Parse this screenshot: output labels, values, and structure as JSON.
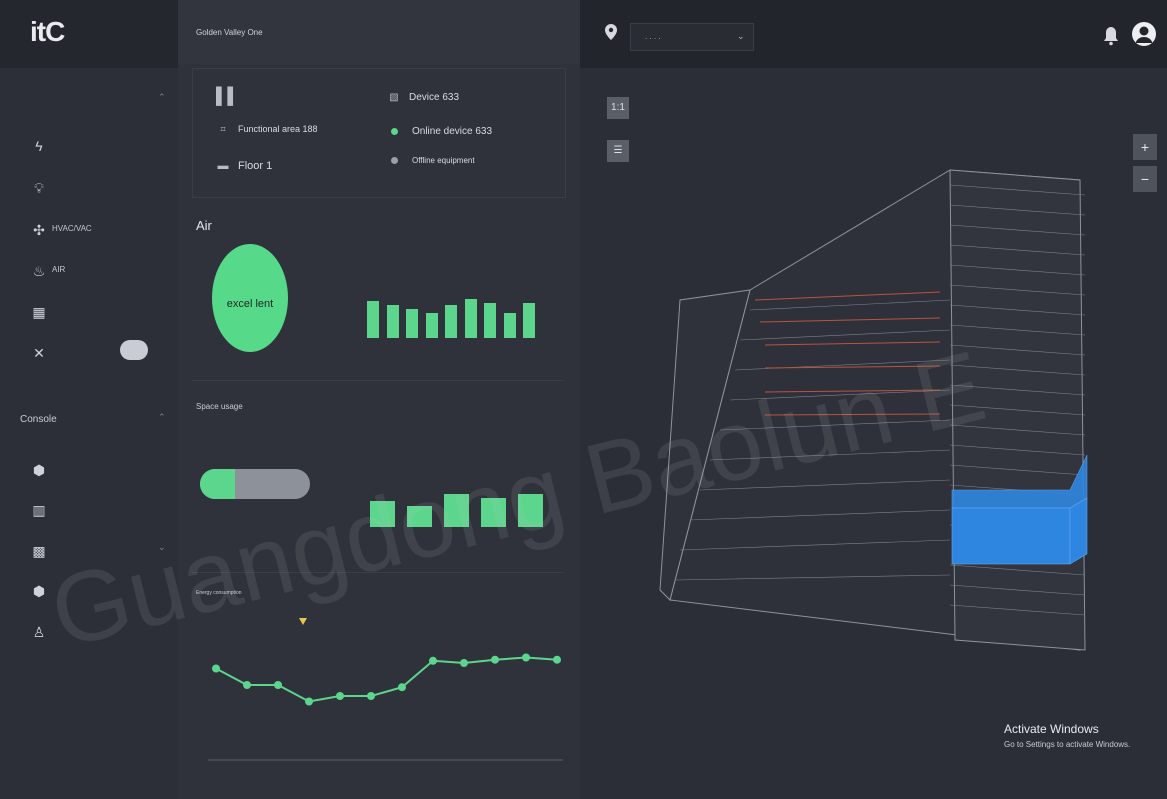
{
  "app": {
    "logo": "itC"
  },
  "sidebar": {
    "section1_title": "",
    "section1_items": [
      {
        "icon": "lightning-icon",
        "label": ""
      },
      {
        "icon": "bulb-icon",
        "label": ""
      },
      {
        "icon": "fan-icon",
        "label": "HVAC/VAC"
      },
      {
        "icon": "air-icon",
        "label": "AIR"
      },
      {
        "icon": "building-icon",
        "label": ""
      },
      {
        "icon": "tools-icon",
        "label": ""
      }
    ],
    "section2_title": "Console",
    "section2_items": [
      {
        "icon": "cube-icon",
        "label": ""
      },
      {
        "icon": "buildings-icon",
        "label": ""
      },
      {
        "icon": "grid-icon",
        "label": ""
      },
      {
        "icon": "shield-icon",
        "label": ""
      },
      {
        "icon": "person-icon",
        "label": ""
      }
    ]
  },
  "panel": {
    "title": "Golden Valley One",
    "info": {
      "functional_area": "Functional area 188",
      "floor": "Floor 1",
      "device": "Device 633",
      "online": "Online device 633",
      "offline": "Offline equipment"
    },
    "air_title": "Air",
    "air_status": "excel lent",
    "air_bars": [
      0.62,
      0.55,
      0.48,
      0.42,
      0.55,
      0.65,
      0.58,
      0.42,
      0.58
    ],
    "space_title": "Space usage",
    "space_progress": 0.32,
    "space_bars": [
      0.55,
      0.45,
      0.7,
      0.62,
      0.7
    ],
    "energy_title": "Energy consumption",
    "energy_line": [
      0.65,
      0.5,
      0.5,
      0.35,
      0.4,
      0.4,
      0.48,
      0.72,
      0.7,
      0.73,
      0.75,
      0.73
    ]
  },
  "map": {
    "location_value": ". . . .",
    "zoom_in": "+",
    "zoom_out": "−",
    "btn_2d": "1:1",
    "btn_list": "☰"
  },
  "windows_notice": {
    "title": "Activate Windows",
    "subtitle": "Go to Settings to activate Windows."
  },
  "watermark": "Guangdong Baolun E",
  "colors": {
    "accent_green": "#5cd68c",
    "highlight_blue": "#2f86e0",
    "bg": "#2a2d36"
  }
}
